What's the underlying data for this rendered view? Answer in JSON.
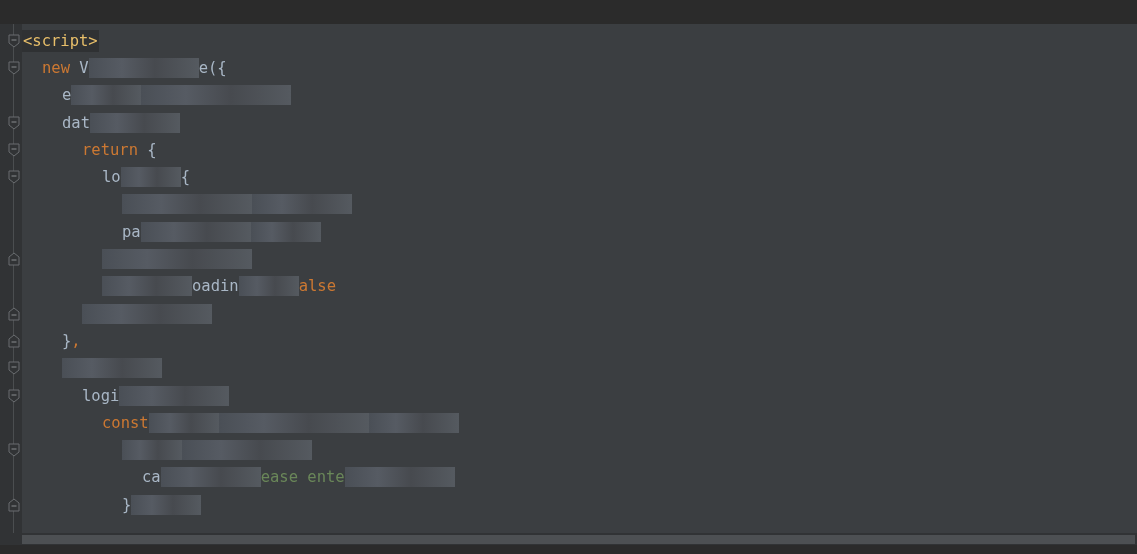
{
  "editor": {
    "lines": [
      {
        "kind": "fold-start",
        "tokens": [
          {
            "kind": "tag",
            "text": "<script>"
          }
        ],
        "children": [
          {
            "kind": "fold-start",
            "tokens": [
              {
                "kind": "keyword",
                "text": "new"
              },
              {
                "kind": "plain",
                "text": " V"
              },
              {
                "kind": "redacted"
              },
              {
                "kind": "plain",
                "text": "e({"
              }
            ],
            "children": [
              {
                "tokens": [
                  {
                    "kind": "plain",
                    "text": "e"
                  },
                  {
                    "kind": "redacted"
                  },
                  {
                    "kind": "redacted"
                  }
                ]
              },
              {
                "kind": "fold-start",
                "tokens": [
                  {
                    "kind": "plain",
                    "text": "dat"
                  },
                  {
                    "kind": "redacted"
                  }
                ],
                "children": [
                  {
                    "kind": "fold-start",
                    "tokens": [
                      {
                        "kind": "keyword",
                        "text": "return"
                      },
                      {
                        "kind": "plain",
                        "text": " {"
                      }
                    ],
                    "children": [
                      {
                        "kind": "fold-start",
                        "tokens": [
                          {
                            "kind": "plain",
                            "text": "lo"
                          },
                          {
                            "kind": "redacted"
                          },
                          {
                            "kind": "plain",
                            "text": "{"
                          }
                        ],
                        "children": [
                          {
                            "tokens": [
                              {
                                "kind": "redacted"
                              },
                              {
                                "kind": "redacted"
                              }
                            ]
                          },
                          {
                            "tokens": [
                              {
                                "kind": "plain",
                                "text": "pa"
                              },
                              {
                                "kind": "redacted"
                              },
                              {
                                "kind": "redacted"
                              }
                            ]
                          }
                        ]
                      },
                      {
                        "kind": "fold-end",
                        "tokens": [
                          {
                            "kind": "redacted"
                          }
                        ]
                      },
                      {
                        "tokens": [
                          {
                            "kind": "redacted"
                          },
                          {
                            "kind": "plain",
                            "text": "oadin"
                          },
                          {
                            "kind": "redacted"
                          },
                          {
                            "kind": "keyword",
                            "text": "alse"
                          }
                        ]
                      }
                    ]
                  },
                  {
                    "kind": "fold-end",
                    "tokens": [
                      {
                        "kind": "redacted"
                      }
                    ]
                  }
                ]
              },
              {
                "kind": "fold-end",
                "tokens": [
                  {
                    "kind": "plain",
                    "text": "}"
                  },
                  {
                    "kind": "keyword",
                    "text": ","
                  }
                ]
              },
              {
                "kind": "fold-start",
                "tokens": [
                  {
                    "kind": "redacted"
                  }
                ],
                "children": [
                  {
                    "kind": "fold-start",
                    "tokens": [
                      {
                        "kind": "plain",
                        "text": "logi"
                      },
                      {
                        "kind": "redacted"
                      }
                    ],
                    "children": [
                      {
                        "tokens": [
                          {
                            "kind": "keyword",
                            "text": "const"
                          },
                          {
                            "kind": "redacted"
                          },
                          {
                            "kind": "redacted"
                          },
                          {
                            "kind": "redacted"
                          }
                        ],
                        "children": [
                          {
                            "kind": "fold-start",
                            "tokens": [
                              {
                                "kind": "redacted"
                              },
                              {
                                "kind": "redacted"
                              }
                            ],
                            "children": [
                              {
                                "tokens": [
                                  {
                                    "kind": "plain",
                                    "text": "ca"
                                  },
                                  {
                                    "kind": "redacted"
                                  },
                                  {
                                    "kind": "string",
                                    "text": "ease ente"
                                  },
                                  {
                                    "kind": "redacted"
                                  }
                                ]
                              }
                            ]
                          },
                          {
                            "kind": "fold-end",
                            "tokens": [
                              {
                                "kind": "plain",
                                "text": "}"
                              },
                              {
                                "kind": "redacted"
                              }
                            ]
                          }
                        ]
                      }
                    ]
                  }
                ]
              }
            ]
          }
        ]
      }
    ]
  }
}
